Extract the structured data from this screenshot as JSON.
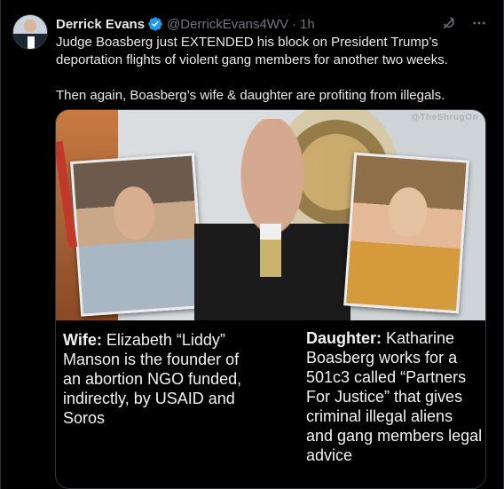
{
  "author": {
    "name": "Derrick Evans",
    "handle": "@DerrickEvans4WV",
    "separator": "·",
    "time": "1h"
  },
  "tweet": {
    "line1": "Judge Boasberg just EXTENDED his block on President Trump’s deportation flights of violent gang members for another two weeks.",
    "line2": "Then again, Boasberg’s wife & daughter are profiting from illegals."
  },
  "media": {
    "watermark": "@TheShrugOn",
    "wife_label": "Wife:",
    "wife_text": "Elizabeth “Liddy” Manson is the founder of an abortion NGO funded, indirectly, by USAID and Soros",
    "daughter_label": "Daughter:",
    "daughter_text": "Katharine Boasberg works for a 501c3 called “Partners For Justice” that gives criminal illegal aliens and gang members legal advice"
  },
  "icons": {
    "verified": "verified-badge-icon",
    "grok": "grok-icon",
    "more": "more-icon"
  },
  "colors": {
    "background": "#000000",
    "verified": "#1d9bf0",
    "secondary_text": "#71767b"
  }
}
